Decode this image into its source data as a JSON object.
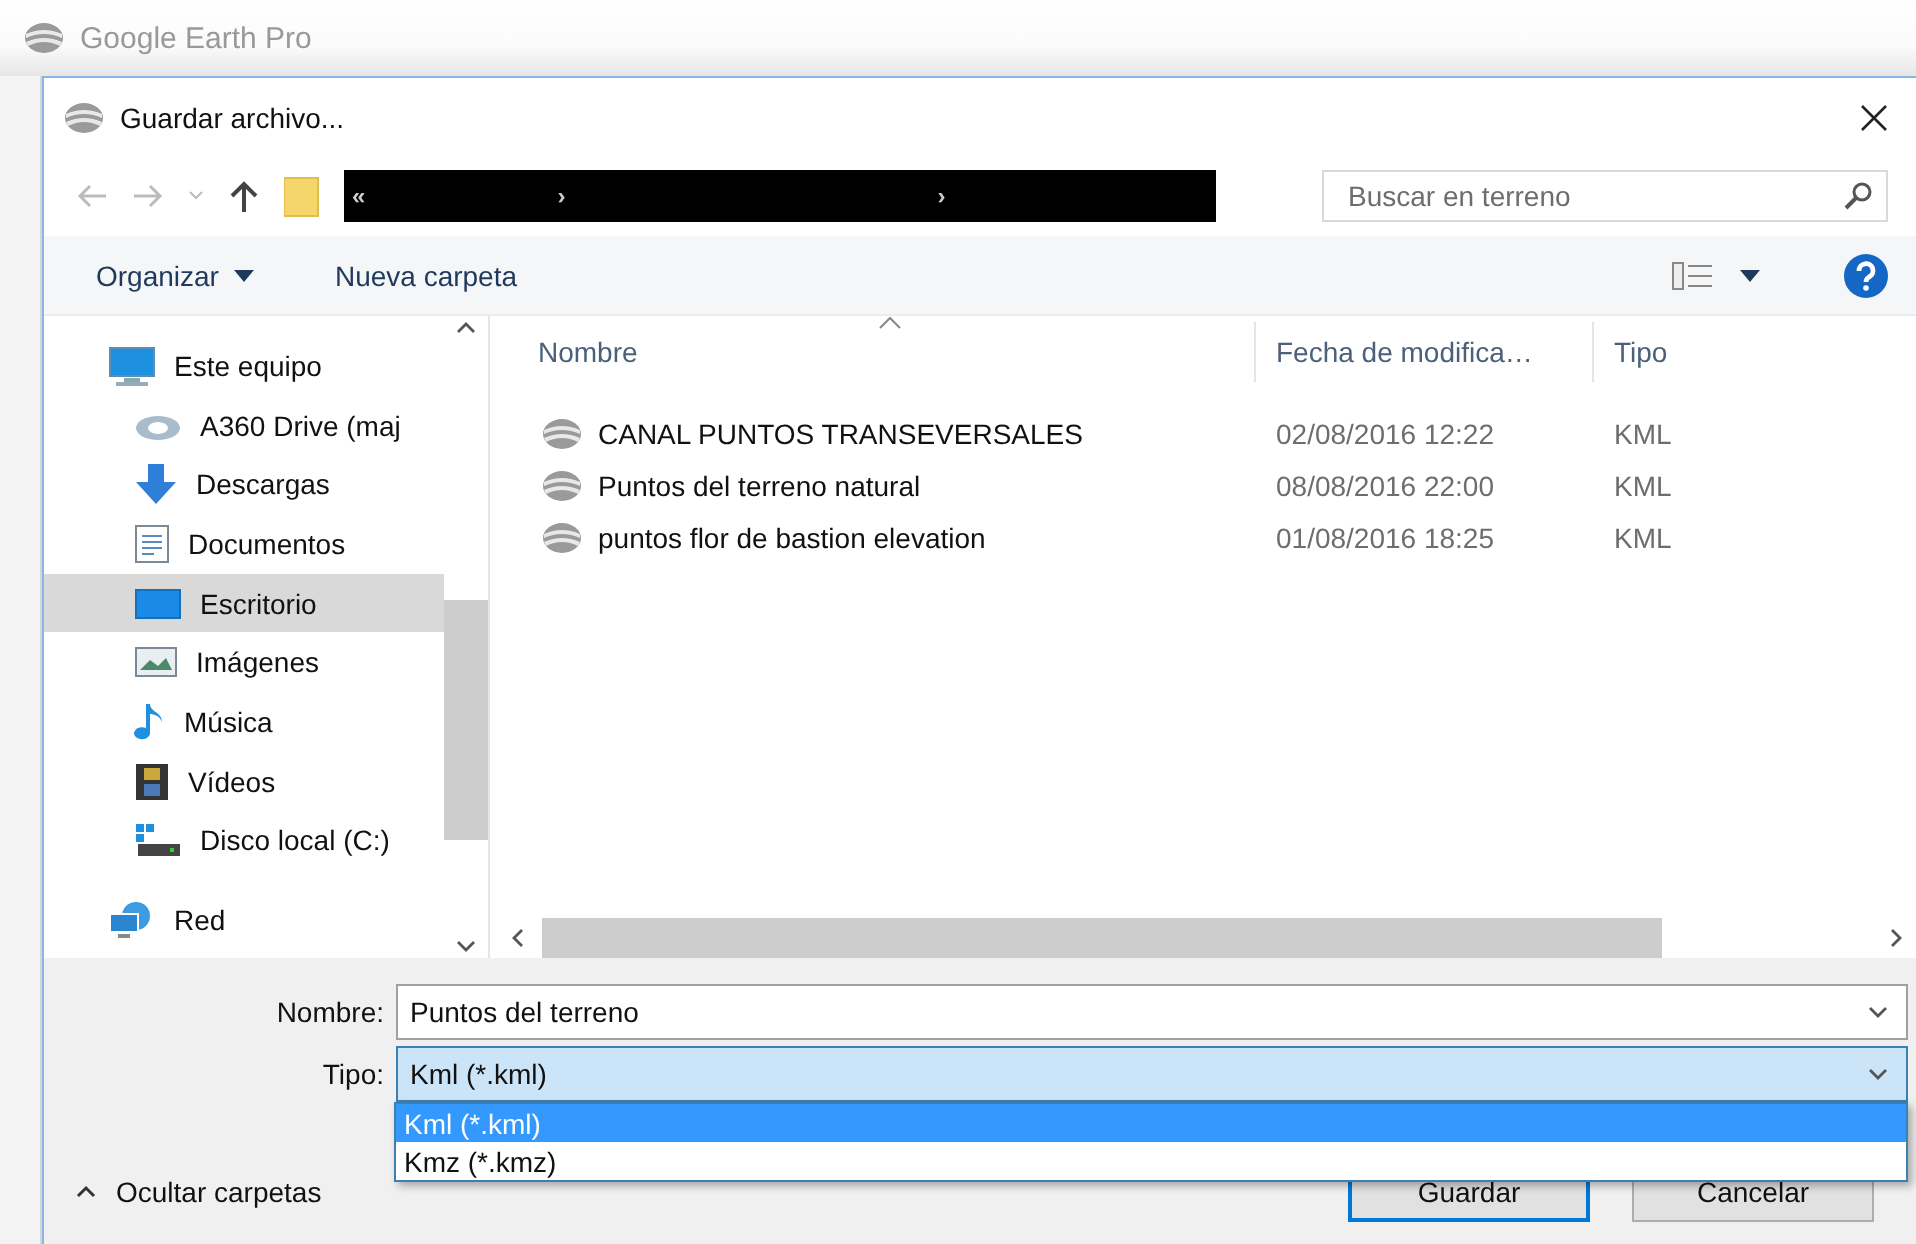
{
  "background_window": {
    "title": "Google Earth Pro"
  },
  "dialog": {
    "title": "Guardar archivo..."
  },
  "address_bar": {
    "separators": [
      "«",
      "›",
      "›"
    ]
  },
  "search": {
    "placeholder": "Buscar en terreno"
  },
  "toolbar": {
    "organize": "Organizar",
    "new_folder": "Nueva carpeta"
  },
  "nav_pane": {
    "items": [
      {
        "label": "Este equipo",
        "selected": false,
        "children": [
          {
            "label": "A360 Drive (maj",
            "selected": false
          },
          {
            "label": "Descargas",
            "selected": false
          },
          {
            "label": "Documentos",
            "selected": false
          },
          {
            "label": "Escritorio",
            "selected": true
          },
          {
            "label": "Imágenes",
            "selected": false
          },
          {
            "label": "Música",
            "selected": false
          },
          {
            "label": "Vídeos",
            "selected": false
          },
          {
            "label": "Disco local (C:)",
            "selected": false
          }
        ]
      },
      {
        "label": "Red",
        "selected": false
      }
    ]
  },
  "file_list": {
    "columns": [
      "Nombre",
      "Fecha de modifica…",
      "Tipo"
    ],
    "rows": [
      {
        "name": "CANAL PUNTOS TRANSEVERSALES",
        "date": "02/08/2016 12:22",
        "type": "KML"
      },
      {
        "name": "Puntos del terreno natural",
        "date": "08/08/2016 22:00",
        "type": "KML"
      },
      {
        "name": "puntos flor de bastion elevation",
        "date": "01/08/2016 18:25",
        "type": "KML"
      }
    ]
  },
  "form": {
    "name_label": "Nombre:",
    "name_value": "Puntos del terreno",
    "type_label": "Tipo:",
    "type_value": "Kml (*.kml)",
    "type_expanded": true,
    "type_options": [
      {
        "label": "Kml (*.kml)",
        "selected": true
      },
      {
        "label": "Kmz (*.kmz)",
        "selected": false
      }
    ]
  },
  "hide_folders": "Ocultar carpetas",
  "buttons": [
    {
      "label": "Guardar",
      "default": true
    },
    {
      "label": "Cancelar",
      "default": false
    }
  ]
}
